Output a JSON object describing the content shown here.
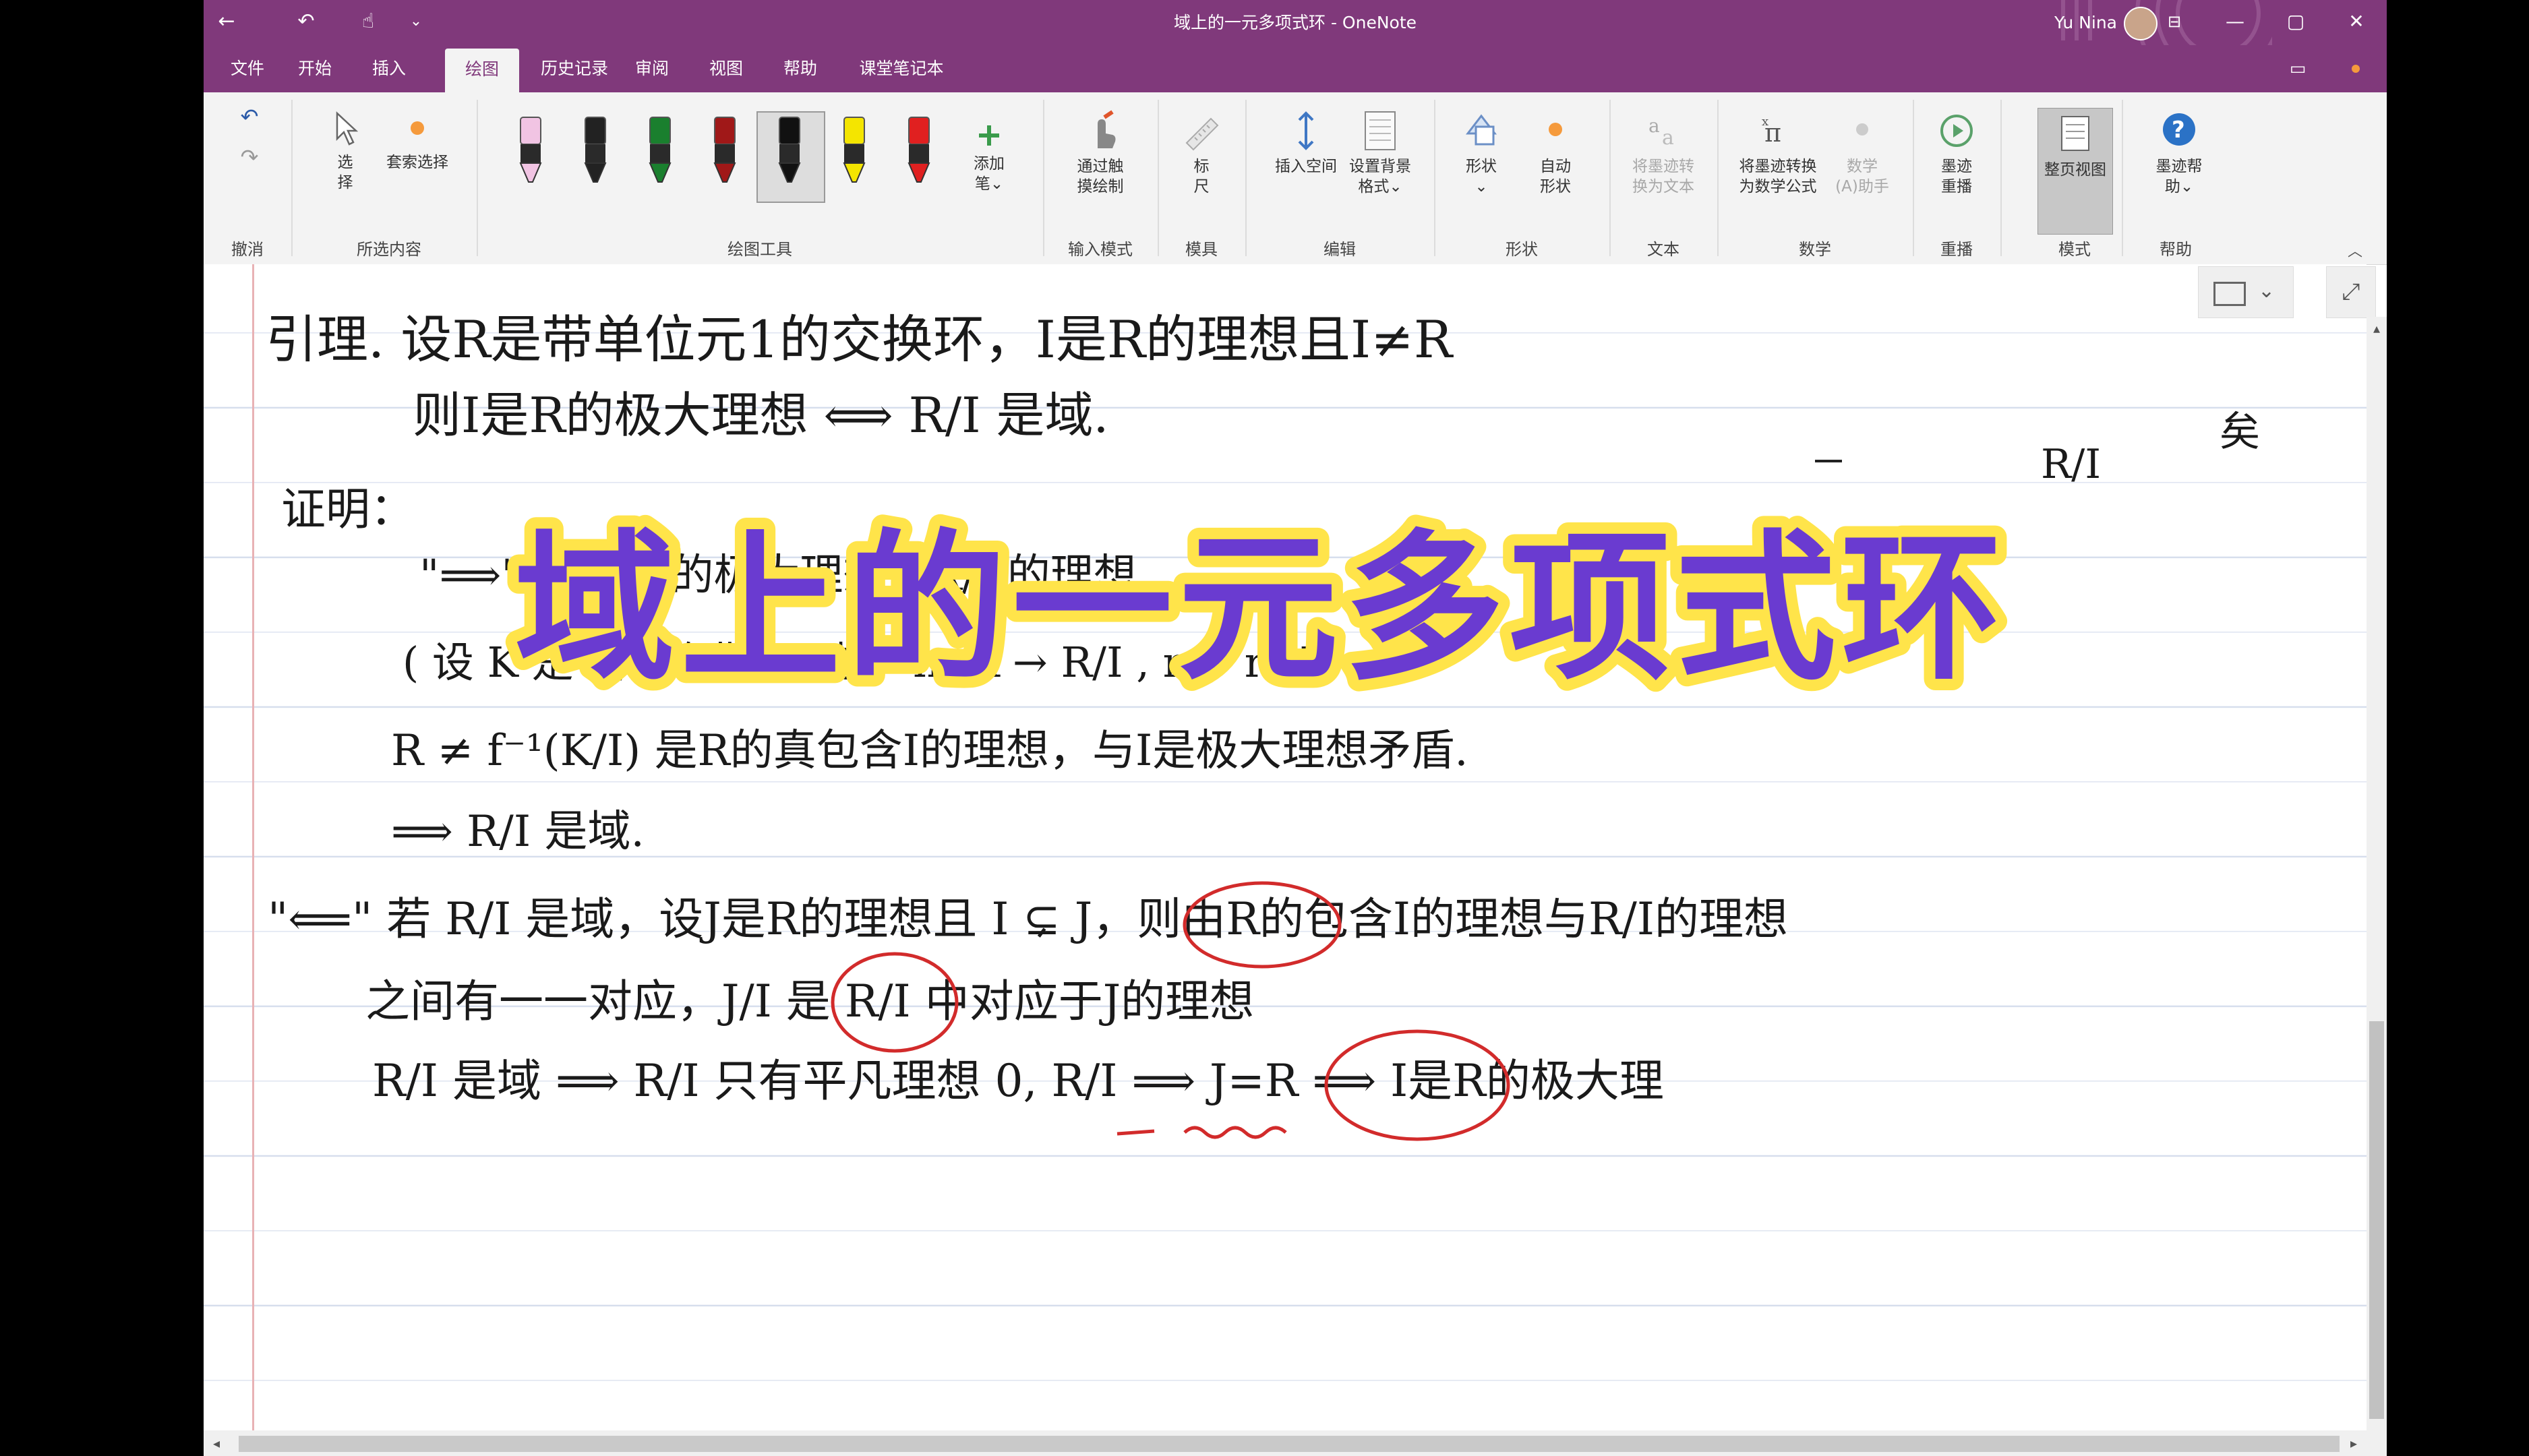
{
  "window": {
    "title": "域上的一元多项式环 - OneNote",
    "user_name": "Yu Nina",
    "controls": {
      "min": "—",
      "max": "▢",
      "close": "✕",
      "ribbon_opts": "⊟"
    }
  },
  "quick_access": {
    "back": "←",
    "undo": "↶",
    "touch": "☝",
    "more": "⌄"
  },
  "tabs": [
    "文件",
    "开始",
    "插入",
    "绘图",
    "历史记录",
    "审阅",
    "视图",
    "帮助",
    "课堂笔记本"
  ],
  "active_tab": "绘图",
  "ribbon": {
    "groups": [
      "撤消",
      "所选内容",
      "绘图工具",
      "输入模式",
      "模具",
      "编辑",
      "形状",
      "文本",
      "数学",
      "重播",
      "模式",
      "帮助"
    ],
    "buttons": {
      "select": "选\n择",
      "lasso": "套索选择",
      "add_pen": "添加\n笔⌄",
      "touch_draw": "通过触\n摸绘制",
      "ruler": "标\n尺",
      "insert_space": "插入空间",
      "bg_format": "设置背景\n格式⌄",
      "shapes": "形状\n⌄",
      "auto_shapes": "自动\n形状",
      "ink_to_text": "将墨迹转\n换为文本",
      "ink_to_math": "将墨迹转换\n为数学公式",
      "math_helper": "数学\n(A)助手",
      "ink_replay": "墨迹\n重播",
      "full_page_view": "整页视图",
      "ink_help": "墨迹帮\n助⌄"
    },
    "pen_colors": [
      "#f1c4e3",
      "#222222",
      "#1a7f2e",
      "#a01818",
      "#111111",
      "#f4e500",
      "#e02020"
    ]
  },
  "note": {
    "lines": [
      "引理. 设R是带单位元1的交换环，I是R的理想且I≠R",
      "则I是R的极大理想 ⟺ R/I 是域.",
      "证明：",
      "\"⟹\" 设I是R的极大理想，R/I 的理想 …",
      "( 设 K 是 R/I 的非零理想，π: R → R/I , r ↦ r+I",
      "R ≠ f⁻¹(K/I) 是R的真包含I的理想，与I是极大理想矛盾.",
      "⟹ R/I 是域.",
      "\"⟸\" 若 R/I 是域，设J是R的理想且 I ⊊ J，则由R的包含I的理想与R/I的理想",
      "之间有一一对应，J/I 是 R/I 中对应于J的理想",
      "R/I 是域 ⟹ R/I 只有平凡理想 0, R/I ⟹ J=R ⟹ I是R的极大理"
    ],
    "side_notes": [
      "R/I",
      "矣"
    ],
    "headline": "域上的一元多项式环"
  }
}
